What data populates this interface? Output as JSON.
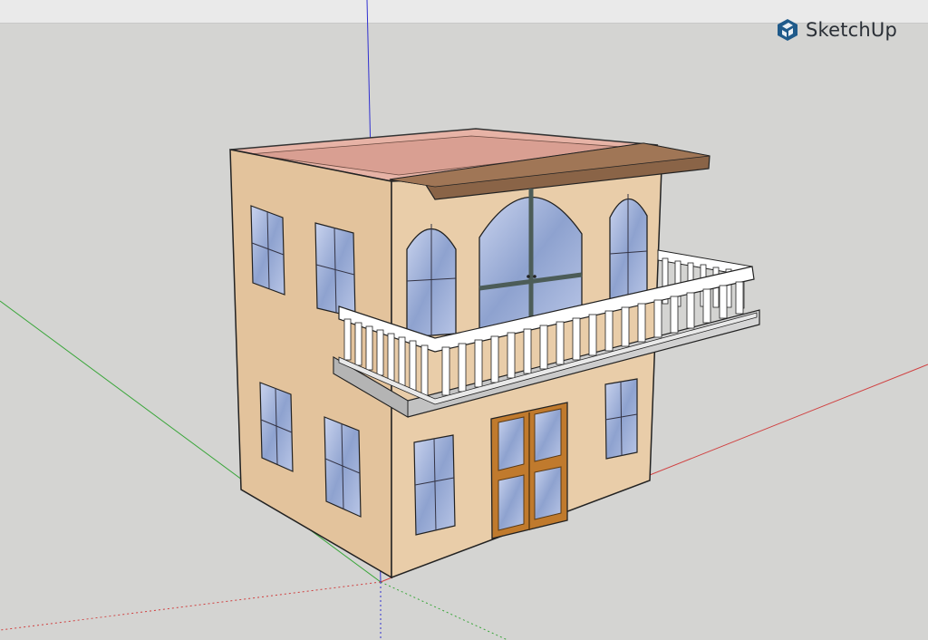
{
  "app": {
    "brand_name": "SketchUp",
    "brand_color": "#1f5a8a",
    "brand_text_color": "#2a2f36",
    "logo_icon": "sketchup-logo-icon"
  },
  "viewport": {
    "background": "#d4d4d2",
    "axes": {
      "red": "#d04040",
      "green": "#3aa63a",
      "blue": "#3030d0"
    }
  },
  "model": {
    "wall_color": "#e6c9a3",
    "wall_shadow_color": "#d8b890",
    "roof_color": "#e7b3a6",
    "eave_color": "#8a6447",
    "glass_color": "#a9b8d9",
    "door_frame_color": "#c07a2d",
    "balcony_color": "#ffffff",
    "slab_color": "#c9c9c9"
  }
}
